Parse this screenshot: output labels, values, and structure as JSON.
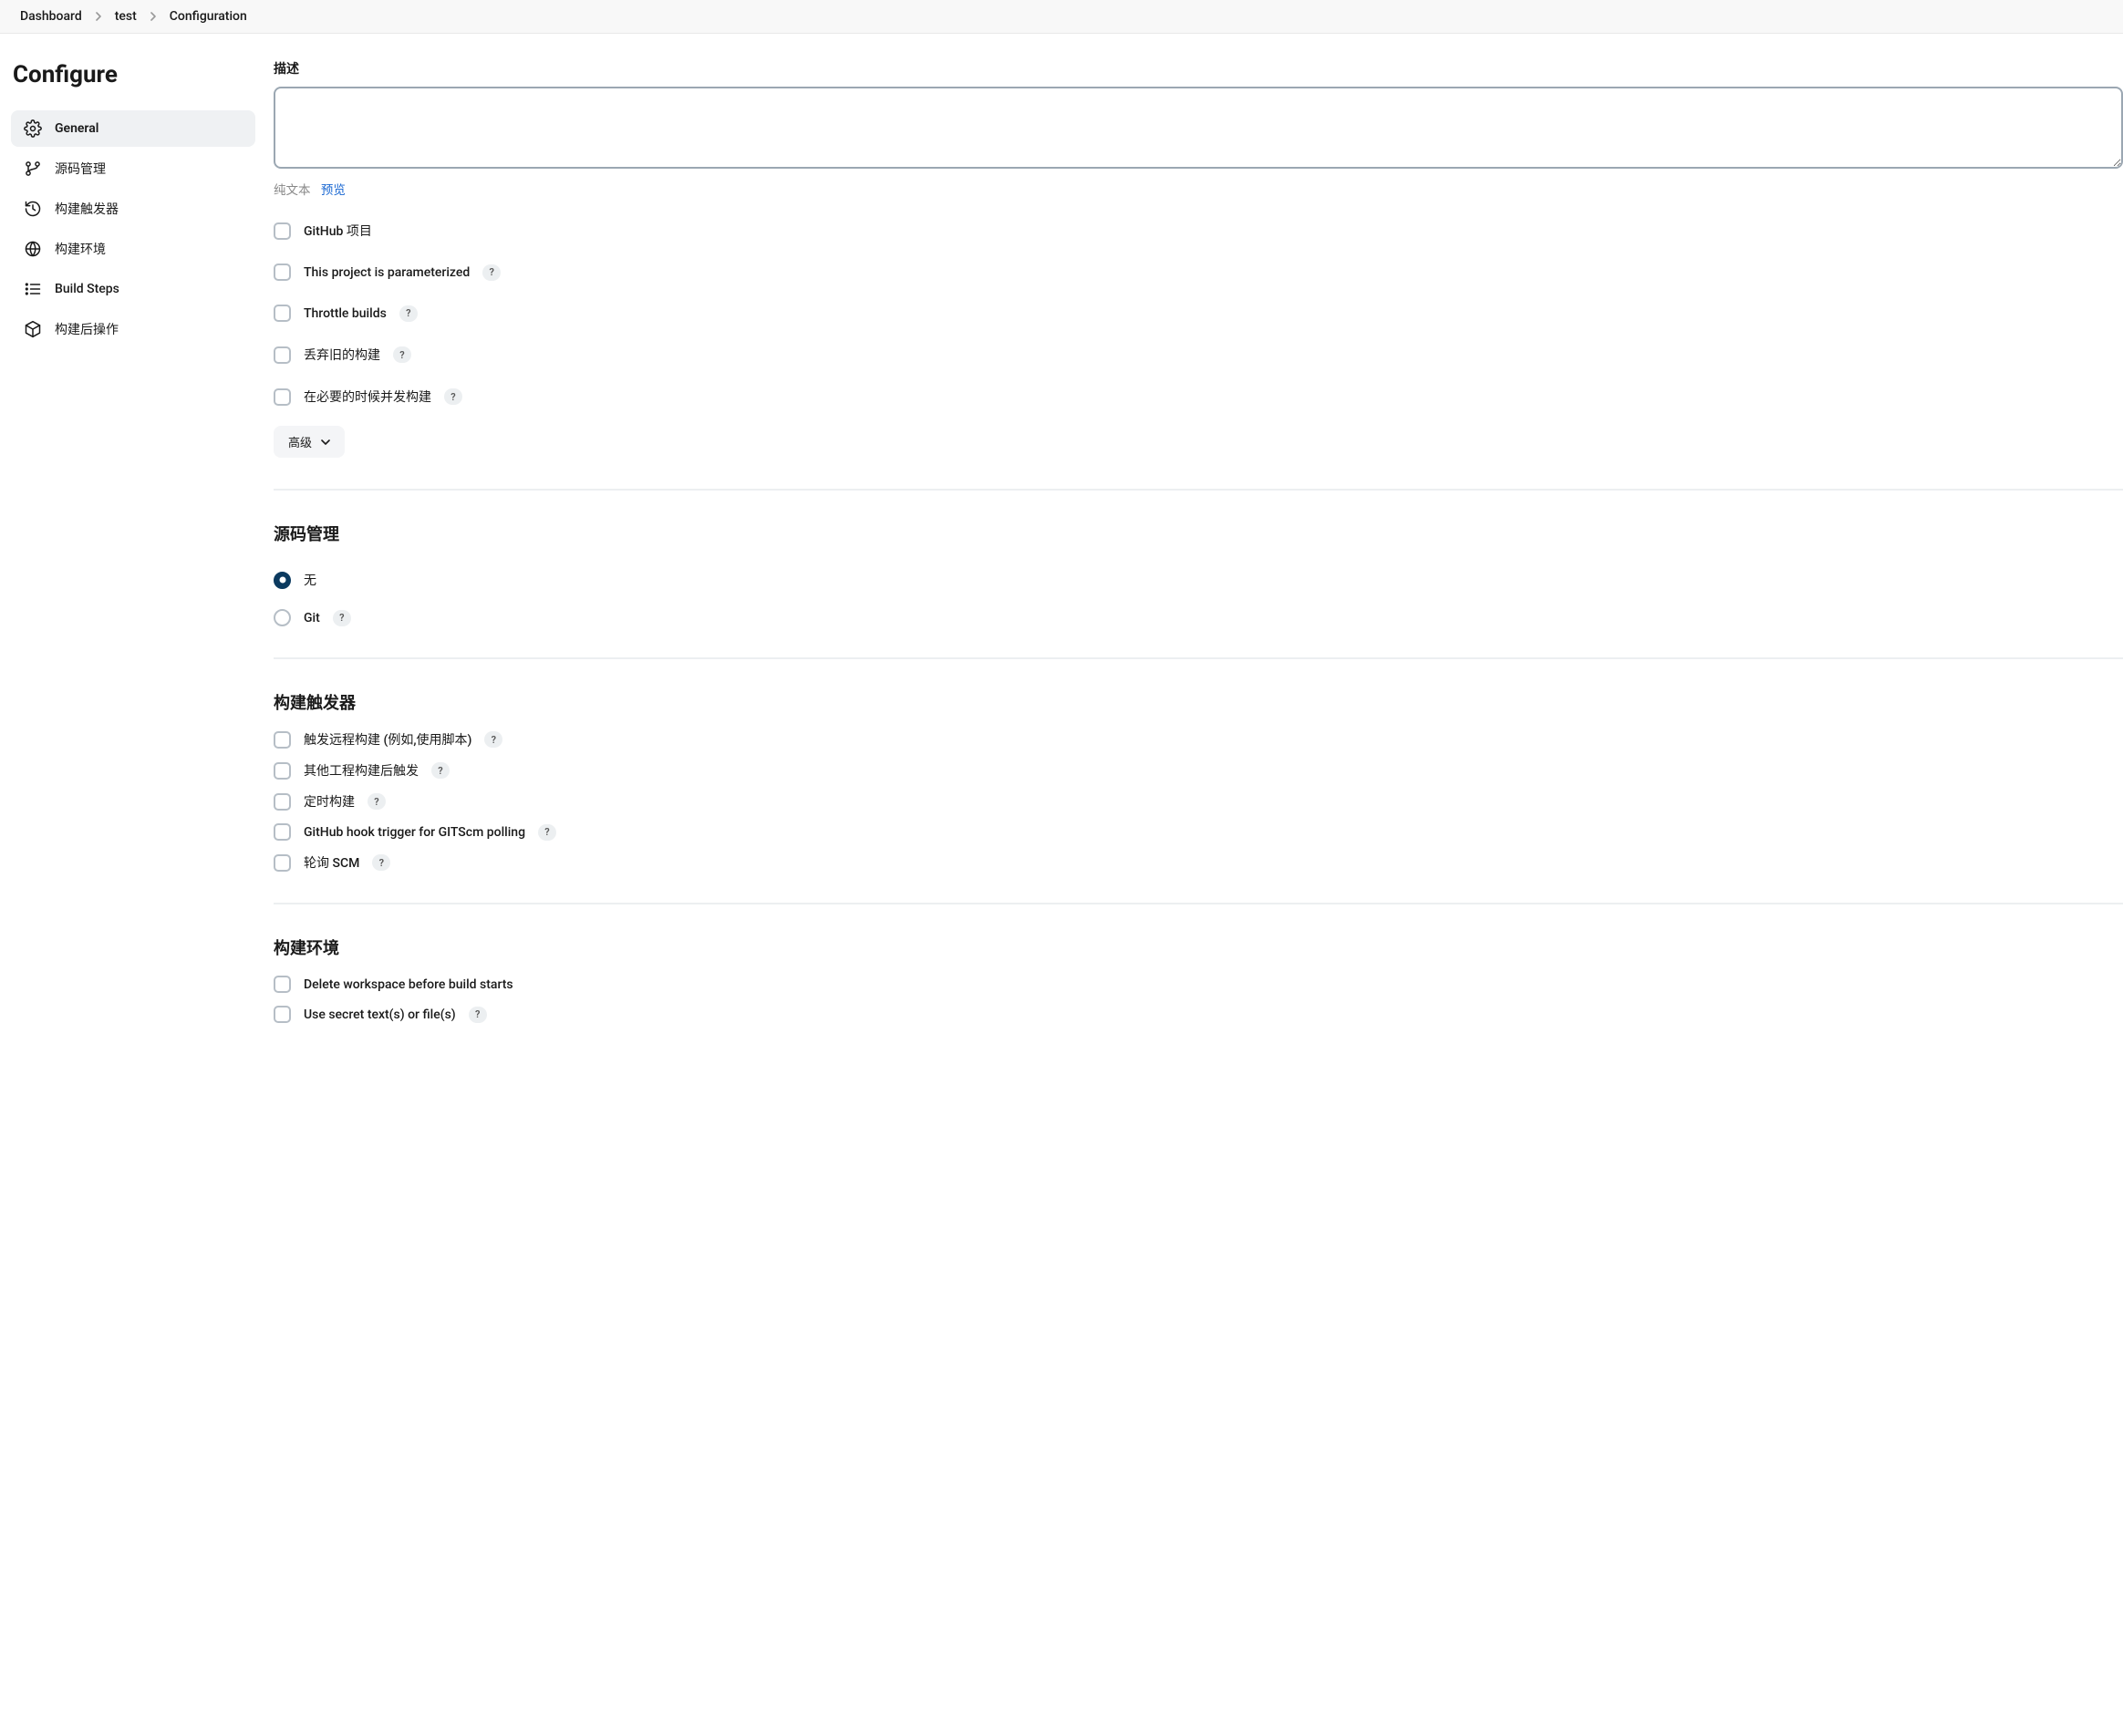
{
  "breadcrumb": {
    "items": [
      "Dashboard",
      "test",
      "Configuration"
    ]
  },
  "sidebar": {
    "title": "Configure",
    "items": [
      {
        "label": "General"
      },
      {
        "label": "源码管理"
      },
      {
        "label": "构建触发器"
      },
      {
        "label": "构建环境"
      },
      {
        "label": "Build Steps"
      },
      {
        "label": "构建后操作"
      }
    ]
  },
  "description": {
    "label": "描述",
    "value": "",
    "plain_text_label": "纯文本",
    "preview_label": "预览"
  },
  "general_checks": [
    {
      "label": "GitHub 项目",
      "help": false
    },
    {
      "label": "This project is parameterized",
      "help": true
    },
    {
      "label": "Throttle builds",
      "help": true
    },
    {
      "label": "丢弃旧的构建",
      "help": true
    },
    {
      "label": "在必要的时候并发构建",
      "help": true
    }
  ],
  "advanced_label": "高级",
  "scm": {
    "title": "源码管理",
    "options": [
      {
        "label": "无",
        "help": false,
        "checked": true
      },
      {
        "label": "Git",
        "help": true,
        "checked": false
      }
    ]
  },
  "triggers": {
    "title": "构建触发器",
    "items": [
      {
        "label": "触发远程构建 (例如,使用脚本)",
        "help": true
      },
      {
        "label": "其他工程构建后触发",
        "help": true
      },
      {
        "label": "定时构建",
        "help": true
      },
      {
        "label": "GitHub hook trigger for GITScm polling",
        "help": true
      },
      {
        "label": "轮询 SCM",
        "help": true
      }
    ]
  },
  "build_env": {
    "title": "构建环境",
    "items": [
      {
        "label": "Delete workspace before build starts",
        "help": false
      },
      {
        "label": "Use secret text(s) or file(s)",
        "help": true
      }
    ]
  },
  "help_symbol": "?"
}
